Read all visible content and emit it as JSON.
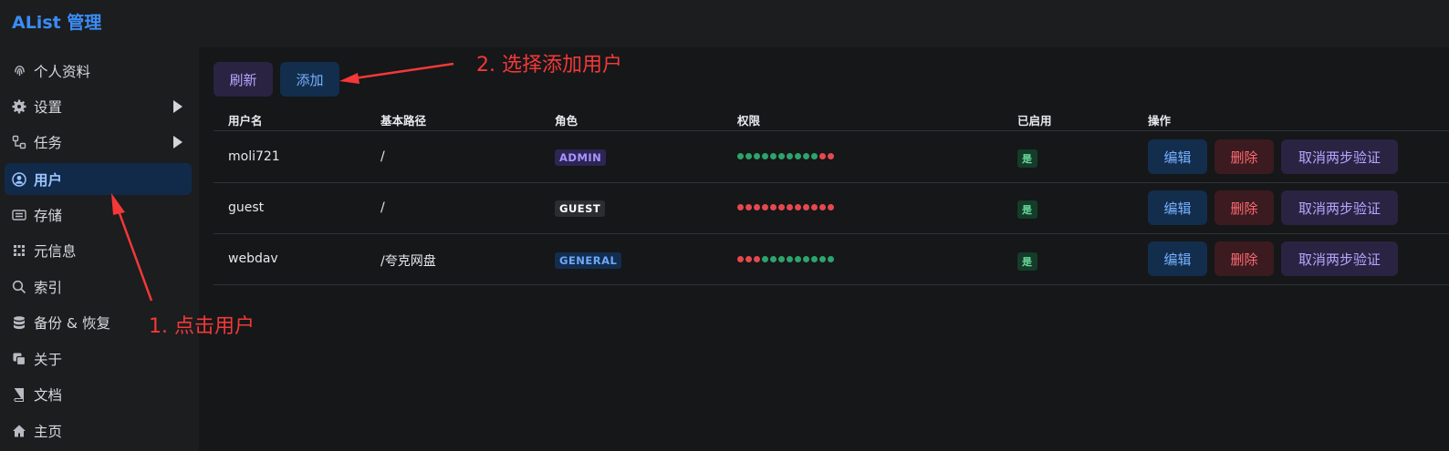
{
  "app": {
    "title": "AList 管理"
  },
  "sidebar": {
    "items": [
      {
        "label": "个人资料",
        "icon": "fingerprint-icon"
      },
      {
        "label": "设置",
        "icon": "gear-icon",
        "expandable": true
      },
      {
        "label": "任务",
        "icon": "tasks-icon",
        "expandable": true
      },
      {
        "label": "用户",
        "icon": "user-circle-icon",
        "active": true
      },
      {
        "label": "存储",
        "icon": "storage-icon"
      },
      {
        "label": "元信息",
        "icon": "meta-icon"
      },
      {
        "label": "索引",
        "icon": "search-icon"
      },
      {
        "label": "备份 & 恢复",
        "icon": "database-icon"
      },
      {
        "label": "关于",
        "icon": "copy-icon"
      },
      {
        "label": "文档",
        "icon": "book-icon"
      },
      {
        "label": "主页",
        "icon": "home-icon"
      }
    ]
  },
  "toolbar": {
    "refresh_label": "刷新",
    "add_label": "添加"
  },
  "table": {
    "headers": [
      "用户名",
      "基本路径",
      "角色",
      "权限",
      "已启用",
      "操作"
    ],
    "rows": [
      {
        "username": "moli721",
        "path": "/",
        "role": "ADMIN",
        "role_color": "#a895ff",
        "permissions": [
          1,
          1,
          1,
          1,
          1,
          1,
          1,
          1,
          1,
          1,
          0,
          0
        ],
        "enabled": "是"
      },
      {
        "username": "guest",
        "path": "/",
        "role": "GUEST",
        "role_color": "#ffffff",
        "permissions": [
          0,
          0,
          0,
          0,
          0,
          0,
          0,
          0,
          0,
          0,
          0,
          0
        ],
        "enabled": "是"
      },
      {
        "username": "webdav",
        "path": "/夸克网盘",
        "role": "GENERAL",
        "role_color": "#6fa8f6",
        "permissions": [
          0,
          0,
          0,
          1,
          1,
          1,
          1,
          1,
          1,
          1,
          1,
          1
        ],
        "enabled": "是"
      }
    ],
    "actions": {
      "edit": "编辑",
      "delete": "删除",
      "disable_2fa": "取消两步验证"
    }
  },
  "annotations": {
    "step1": "1. 点击用户",
    "step2": "2. 选择添加用户"
  },
  "colors": {
    "accent": "#3b8cf5",
    "annotation": "#f33838",
    "perm_on": "#2ea36b",
    "perm_off": "#e5484d"
  }
}
